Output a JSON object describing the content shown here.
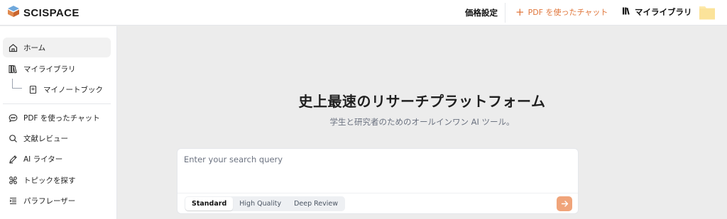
{
  "header": {
    "logo_text": "SCISPACE",
    "pricing_label": "価格設定",
    "chat_pdf_label": "PDF を使ったチャット",
    "my_library_label": "マイライブラリ"
  },
  "sidebar": {
    "items": [
      {
        "label": "ホーム",
        "icon": "home-icon"
      },
      {
        "label": "マイライブラリ",
        "icon": "library-icon"
      },
      {
        "label": "マイノートブック",
        "icon": "notebook-icon"
      },
      {
        "label": "PDF を使ったチャット",
        "icon": "chat-icon"
      },
      {
        "label": "文献レビュー",
        "icon": "search-doc-icon"
      },
      {
        "label": "AI ライター",
        "icon": "pen-icon"
      },
      {
        "label": "トピックを探す",
        "icon": "topics-icon"
      },
      {
        "label": "パラフレーザー",
        "icon": "paraphrase-icon"
      }
    ]
  },
  "main": {
    "title": "史上最速のリサーチプラットフォーム",
    "subtitle": "学生と研究者のためのオールインワン AI ツール。",
    "search": {
      "placeholder": "Enter your search query",
      "value": "",
      "modes": [
        "Standard",
        "High Quality",
        "Deep Review"
      ],
      "selected_mode": "Standard"
    }
  },
  "colors": {
    "accent": "#e0763b",
    "submit_bg": "#f0a47a",
    "main_bg": "#ececec",
    "folder": "#fde9a9"
  }
}
